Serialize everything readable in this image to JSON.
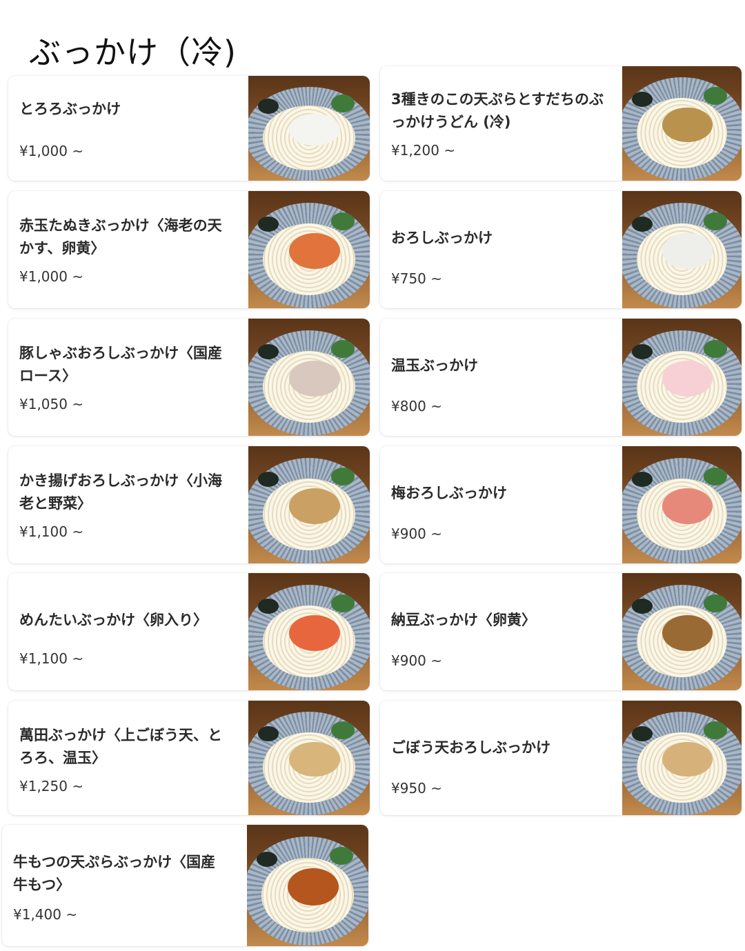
{
  "page": {
    "title": "ぶっかけ（冷)"
  },
  "items": [
    {
      "name": "とろろぶっかけ",
      "price": "¥1,000 ~",
      "photo": "udon-photo",
      "topping": "#f4f4f0"
    },
    {
      "name": "3種きのこの天ぷらとすだちのぶっかけうどん (冷)",
      "price": "¥1,200 ~",
      "photo": "udon-photo",
      "topping": "#b9924e"
    },
    {
      "name": "赤玉たぬきぶっかけ〈海老の天かす、卵黄〉",
      "price": "¥1,000 ~",
      "photo": "udon-photo",
      "topping": "#e0743c"
    },
    {
      "name": "おろしぶっかけ",
      "price": "¥750 ~",
      "photo": "udon-photo",
      "topping": "#eeeeea"
    },
    {
      "name": "豚しゃぶおろしぶっかけ〈国産ロース〉",
      "price": "¥1,050 ~",
      "photo": "udon-photo",
      "topping": "#d9c8be"
    },
    {
      "name": "温玉ぶっかけ",
      "price": "¥800 ~",
      "photo": "udon-photo",
      "topping": "#f6d0d4"
    },
    {
      "name": "かき揚げおろしぶっかけ〈小海老と野菜〉",
      "price": "¥1,100 ~",
      "photo": "udon-photo",
      "topping": "#caa064"
    },
    {
      "name": "梅おろしぶっかけ",
      "price": "¥900 ~",
      "photo": "udon-photo",
      "topping": "#e6897a"
    },
    {
      "name": "めんたいぶっかけ〈卵入り〉",
      "price": "¥1,100 ~",
      "photo": "udon-photo",
      "topping": "#e8663e"
    },
    {
      "name": "納豆ぶっかけ〈卵黄〉",
      "price": "¥900 ~",
      "photo": "udon-photo",
      "topping": "#9a6a34"
    },
    {
      "name": "萬田ぶっかけ〈上ごぼう天、とろろ、温玉〉",
      "price": "¥1,250 ~",
      "photo": "udon-photo",
      "topping": "#d8b57a"
    },
    {
      "name": "ごぼう天おろしぶっかけ",
      "price": "¥950 ~",
      "photo": "udon-photo",
      "topping": "#d6b27a"
    },
    {
      "name": "牛もつの天ぷらぶっかけ〈国産牛もつ〉",
      "price": "¥1,400 ~",
      "photo": "udon-photo",
      "topping": "#b4561e"
    }
  ]
}
